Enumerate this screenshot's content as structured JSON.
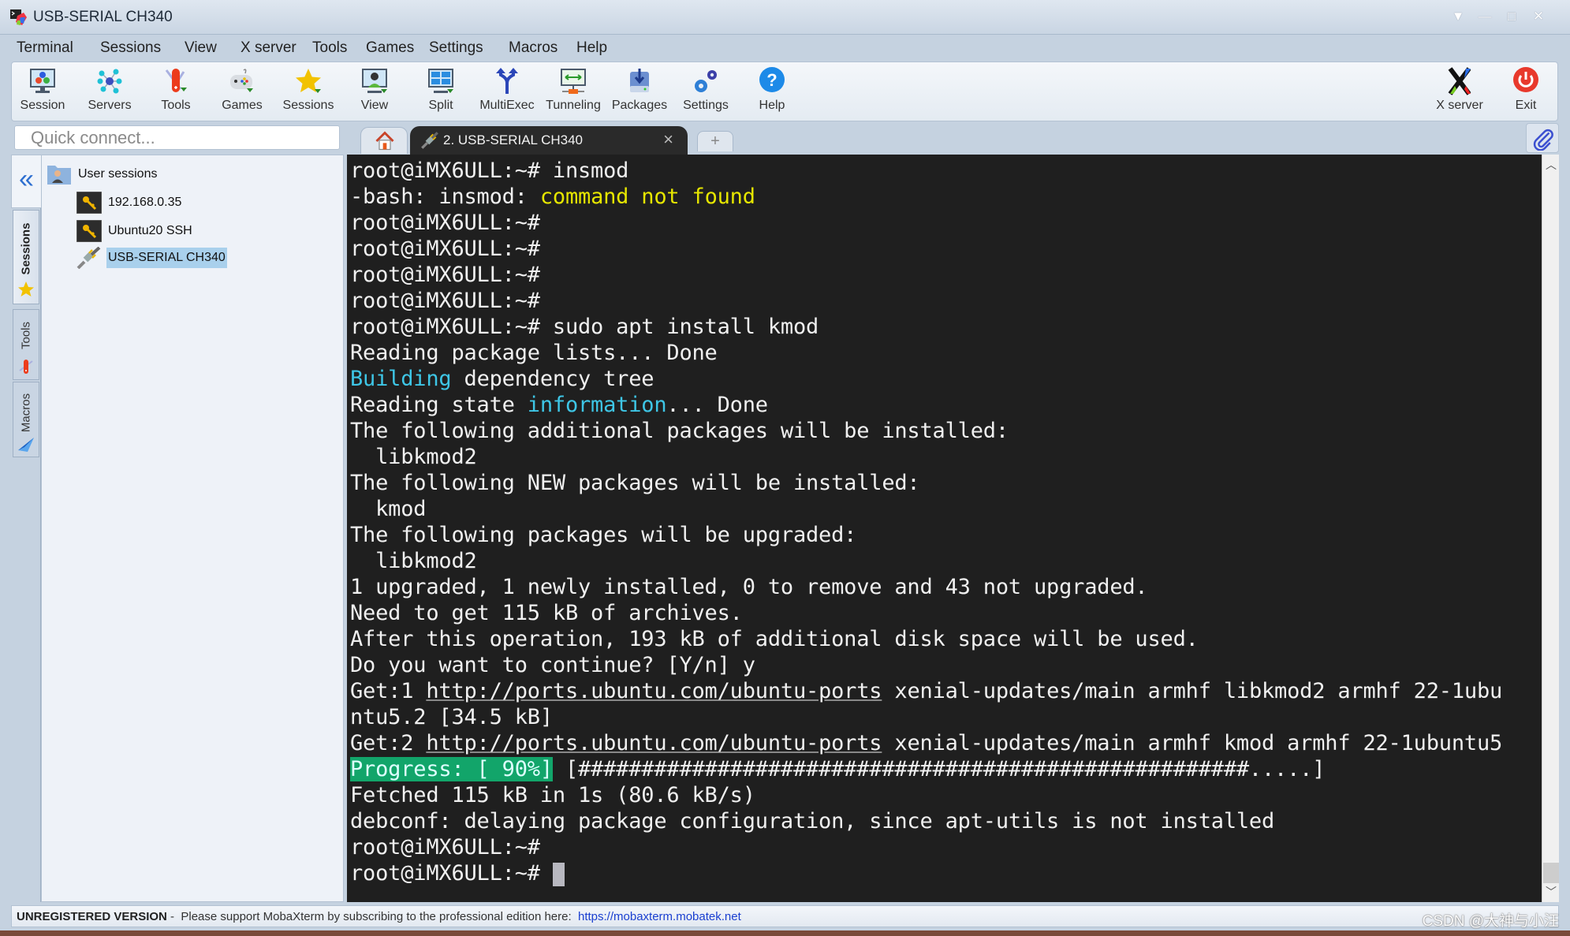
{
  "window": {
    "title": "USB-SERIAL CH340",
    "controls": [
      "dropdown",
      "minimize",
      "maximize",
      "close"
    ]
  },
  "menu": [
    "Terminal",
    "Sessions",
    "View",
    "X server",
    "Tools",
    "Games",
    "Settings",
    "Macros",
    "Help"
  ],
  "toolbar": {
    "left": [
      {
        "label": "Session",
        "icon": "session-icon"
      },
      {
        "label": "Servers",
        "icon": "servers-icon"
      },
      {
        "label": "Tools",
        "icon": "tools-icon"
      },
      {
        "label": "Games",
        "icon": "games-icon"
      },
      {
        "label": "Sessions",
        "icon": "star-icon"
      },
      {
        "label": "View",
        "icon": "view-icon"
      },
      {
        "label": "Split",
        "icon": "split-icon"
      },
      {
        "label": "MultiExec",
        "icon": "multiexec-icon"
      },
      {
        "label": "Tunneling",
        "icon": "tunneling-icon"
      },
      {
        "label": "Packages",
        "icon": "packages-icon"
      },
      {
        "label": "Settings",
        "icon": "settings-icon"
      },
      {
        "label": "Help",
        "icon": "help-icon"
      }
    ],
    "right": [
      {
        "label": "X server",
        "icon": "x-server-icon"
      },
      {
        "label": "Exit",
        "icon": "power-icon"
      }
    ]
  },
  "quick_connect": {
    "placeholder": "Quick connect..."
  },
  "tabs": {
    "active_label": "2. USB-SERIAL CH340",
    "close_glyph": "×",
    "new_glyph": "+"
  },
  "sidebar": {
    "collapse_glyph": "«",
    "vertical_tabs": [
      "Sessions",
      "Tools",
      "Macros"
    ],
    "root": "User sessions",
    "sessions": [
      {
        "label": "192.168.0.35",
        "type": "ssh",
        "selected": false
      },
      {
        "label": "Ubuntu20 SSH",
        "type": "ssh",
        "selected": false
      },
      {
        "label": "USB-SERIAL CH340",
        "type": "serial",
        "selected": true
      }
    ]
  },
  "terminal": {
    "prompt": "root@iMX6ULL:~#",
    "lines": [
      [
        {
          "t": "root@iMX6ULL:~# insmod"
        }
      ],
      [
        {
          "t": "-bash: insmod: "
        },
        {
          "t": "command not found",
          "c": "yellow"
        }
      ],
      [
        {
          "t": "root@iMX6ULL:~#"
        }
      ],
      [
        {
          "t": "root@iMX6ULL:~#"
        }
      ],
      [
        {
          "t": "root@iMX6ULL:~#"
        }
      ],
      [
        {
          "t": "root@iMX6ULL:~#"
        }
      ],
      [
        {
          "t": "root@iMX6ULL:~# sudo apt install kmod"
        }
      ],
      [
        {
          "t": "Reading package lists... Done"
        }
      ],
      [
        {
          "t": "Building",
          "c": "cyan"
        },
        {
          "t": " dependency tree"
        }
      ],
      [
        {
          "t": "Reading state "
        },
        {
          "t": "information",
          "c": "cyan"
        },
        {
          "t": "... Done"
        }
      ],
      [
        {
          "t": "The following additional packages will be installed:"
        }
      ],
      [
        {
          "t": "  libkmod2"
        }
      ],
      [
        {
          "t": "The following NEW packages will be installed:"
        }
      ],
      [
        {
          "t": "  kmod"
        }
      ],
      [
        {
          "t": "The following packages will be upgraded:"
        }
      ],
      [
        {
          "t": "  libkmod2"
        }
      ],
      [
        {
          "t": "1 upgraded, 1 newly installed, 0 to remove and 43 not upgraded."
        }
      ],
      [
        {
          "t": "Need to get 115 kB of archives."
        }
      ],
      [
        {
          "t": "After this operation, 193 kB of additional disk space will be used."
        }
      ],
      [
        {
          "t": "Do you want to continue? [Y/n] y"
        }
      ],
      [
        {
          "t": "Get:1 "
        },
        {
          "t": "http://ports.ubuntu.com/ubuntu-ports",
          "c": "link"
        },
        {
          "t": " xenial-updates/main armhf libkmod2 armhf 22-1ubu"
        }
      ],
      [
        {
          "t": "ntu5.2 [34.5 kB]"
        }
      ],
      [
        {
          "t": "Get:2 "
        },
        {
          "t": "http://ports.ubuntu.com/ubuntu-ports",
          "c": "link"
        },
        {
          "t": " xenial-updates/main armhf kmod armhf 22-1ubuntu5"
        }
      ],
      [
        {
          "t": "Progress: [ 90%]",
          "c": "green-bg"
        },
        {
          "t": " [#####################################################.....]"
        }
      ],
      [
        {
          "t": "Fetched 115 kB in 1s (80.6 kB/s)"
        }
      ],
      [
        {
          "t": "debconf: delaying package configuration, since apt-utils is not installed"
        }
      ],
      [
        {
          "t": "root@iMX6ULL:~#"
        }
      ],
      [
        {
          "t": "root@iMX6ULL:~# "
        },
        {
          "t": "",
          "c": "cursor"
        }
      ]
    ],
    "progress_percent": 90
  },
  "statusbar": {
    "unregistered": "UNREGISTERED VERSION",
    "message": " -  Please support MobaXterm by subscribing to the professional edition here:  ",
    "link": "https://mobaxterm.mobatek.net"
  },
  "watermark": "CSDN @大神与小汪",
  "colors": {
    "terminal_bg": "#1f1f1f",
    "terminal_fg": "#f0f0f0",
    "yellow": "#e6e600",
    "cyan": "#3ec6e6",
    "progress_bg": "#12a56a",
    "selection": "#a9d0ec",
    "chrome": "#c5d2e0"
  }
}
